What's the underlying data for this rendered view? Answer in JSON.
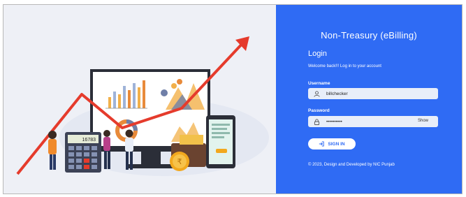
{
  "app": {
    "title": "Non-Treasury (eBilling)"
  },
  "login": {
    "heading": "Login",
    "welcome": "Welcome back!!! Log in to your account",
    "username_label": "Username",
    "username_value": "billchecker",
    "password_label": "Password",
    "password_value": "••••••••••",
    "show_label": "Show",
    "signin_label": "SIGN IN"
  },
  "calculator": {
    "display": "16783"
  },
  "footer": {
    "text": "© 2023, Design and Developed by NIC Punjab"
  },
  "colors": {
    "panel": "#2f6bf4",
    "trend": "#e53b2c",
    "illustration_bg": "#eef0f6"
  },
  "icons": [
    "user-icon",
    "lock-icon",
    "sign-in-icon",
    "rupee-icon"
  ]
}
